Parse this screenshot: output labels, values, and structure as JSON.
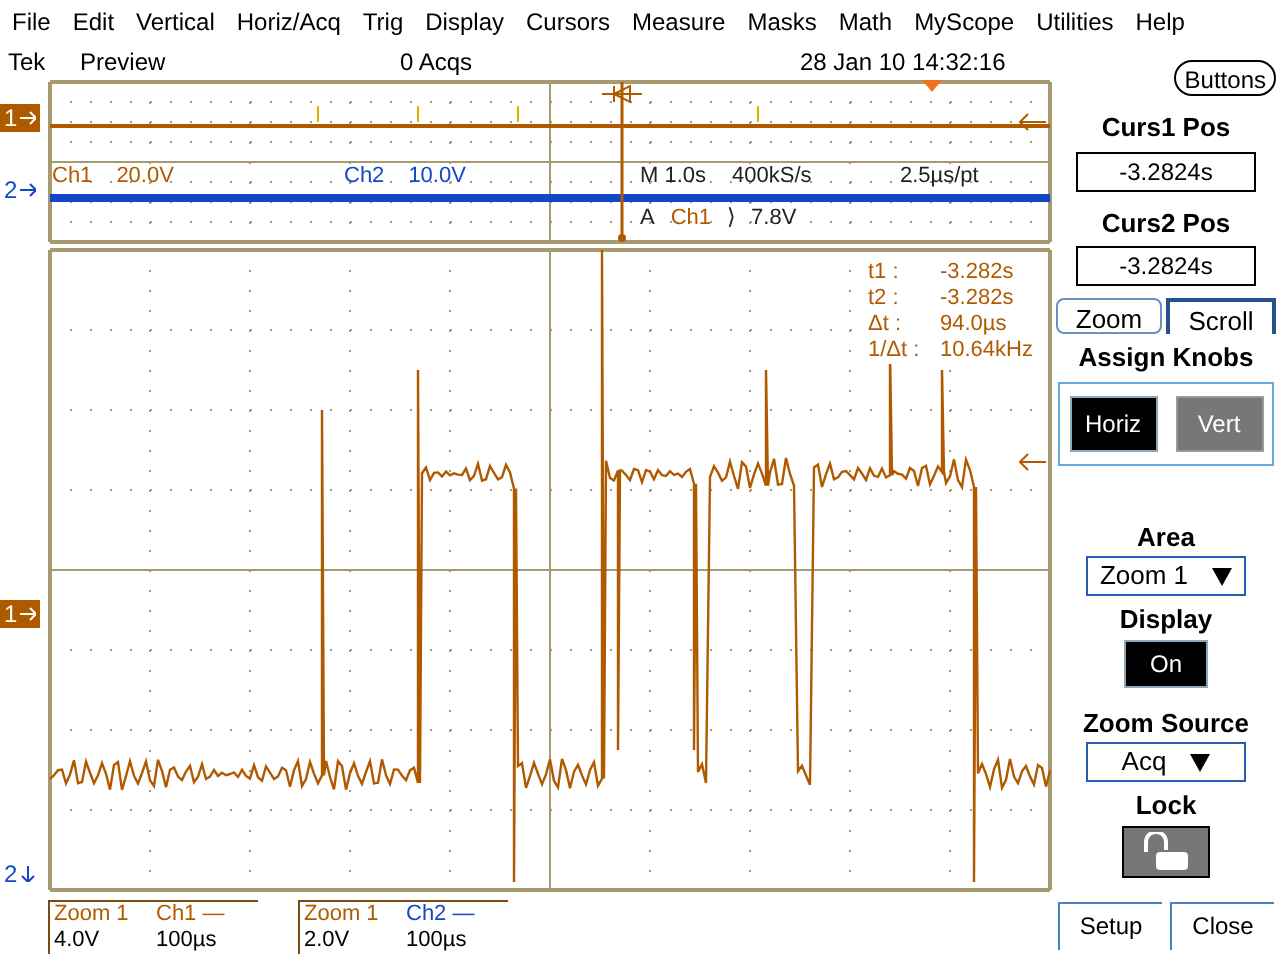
{
  "menu": [
    "File",
    "Edit",
    "Vertical",
    "Horiz/Acq",
    "Trig",
    "Display",
    "Cursors",
    "Measure",
    "Masks",
    "Math",
    "MyScope",
    "Utilities",
    "Help"
  ],
  "status": {
    "brand": "Tek",
    "mode": "Preview",
    "acqs": "0 Acqs",
    "datetime": "28 Jan 10 14:32:16"
  },
  "buttons_toggle": "Buttons",
  "overview": {
    "ch1_marker": "1",
    "ch2_marker": "2",
    "ch1_label": "Ch1",
    "ch1_scale": "20.0V",
    "ch2_label": "Ch2",
    "ch2_scale": "10.0V",
    "timebase": "M 1.0s",
    "sample_rate": "400kS/s",
    "resolution": "2.5µs/pt",
    "trigger_mode": "A",
    "trigger_source": "Ch1",
    "trigger_slope": "⟩",
    "trigger_level": "7.8V"
  },
  "zoom_view": {
    "ch1_marker": "1",
    "ch2_marker": "2",
    "cursor_readout": [
      {
        "label": "t1 :",
        "value": "-3.282s"
      },
      {
        "label": "t2 :",
        "value": "-3.282s"
      },
      {
        "label": "Δt :",
        "value": "94.0µs"
      },
      {
        "label": "1/Δt :",
        "value": "10.64kHz"
      }
    ]
  },
  "readouts": [
    {
      "zoom": "Zoom 1",
      "channel": "Ch1 —",
      "scale": "4.0V",
      "time": "100µs",
      "color": "#b05a00"
    },
    {
      "zoom": "Zoom 1",
      "channel": "Ch2 —",
      "scale": "2.0V",
      "time": "100µs",
      "color": "#1446c8"
    }
  ],
  "panel": {
    "curs1": {
      "title": "Curs1 Pos",
      "value": "-3.2824s"
    },
    "curs2": {
      "title": "Curs2 Pos",
      "value": "-3.2824s"
    },
    "tabs": [
      {
        "label": "Zoom",
        "selected": false
      },
      {
        "label": "Scroll",
        "selected": true
      }
    ],
    "assign_knobs": {
      "title": "Assign Knobs",
      "buttons": [
        {
          "label": "Horiz",
          "selected": true
        },
        {
          "label": "Vert",
          "selected": false
        }
      ]
    },
    "area": {
      "title": "Area",
      "value": "Zoom 1"
    },
    "display": {
      "title": "Display",
      "value": "On"
    },
    "zoom_source": {
      "title": "Zoom Source",
      "value": "Acq"
    },
    "lock": {
      "title": "Lock"
    },
    "footer": [
      "Setup",
      "Close"
    ]
  }
}
